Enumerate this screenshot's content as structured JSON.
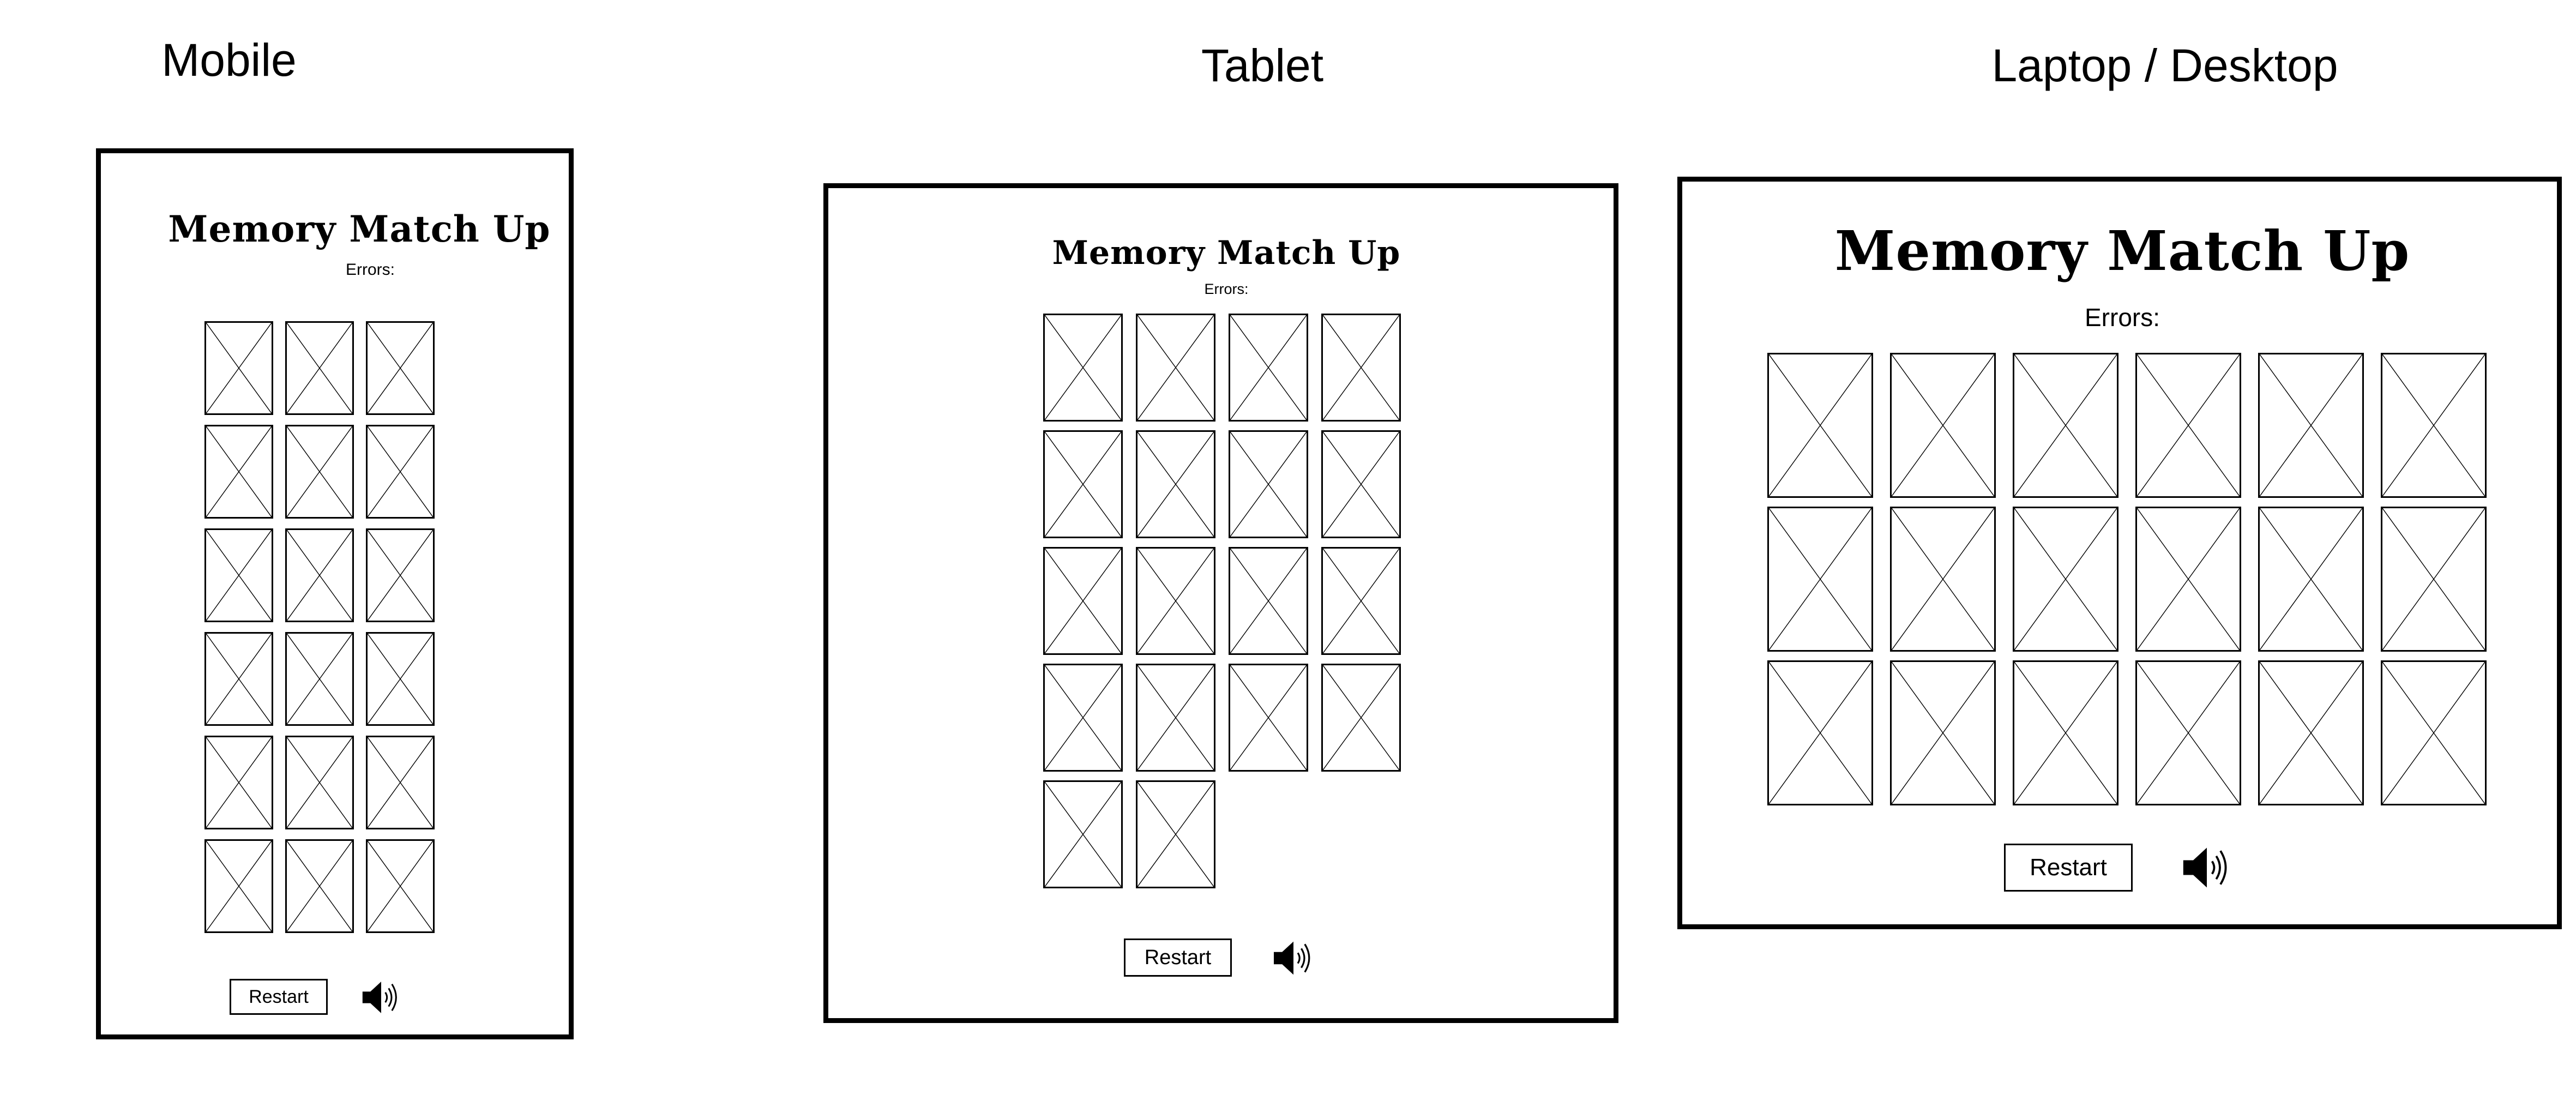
{
  "views": {
    "mobile": {
      "label": "Mobile",
      "title": "Memory Match Up",
      "errors_label": "Errors:",
      "restart_label": "Restart",
      "tile_count": 18,
      "columns": 3
    },
    "tablet": {
      "label": "Tablet",
      "title": "Memory Match Up",
      "errors_label": "Errors:",
      "restart_label": "Restart",
      "tile_count": 18,
      "columns": 4
    },
    "desktop": {
      "label": "Laptop / Desktop",
      "title": "Memory Match Up",
      "errors_label": "Errors:",
      "restart_label": "Restart",
      "tile_count": 18,
      "columns": 6
    }
  },
  "icons": {
    "tile_placeholder": "image-placeholder-icon",
    "sound": "speaker-icon"
  },
  "colors": {
    "stroke": "#000000",
    "background": "#ffffff"
  }
}
